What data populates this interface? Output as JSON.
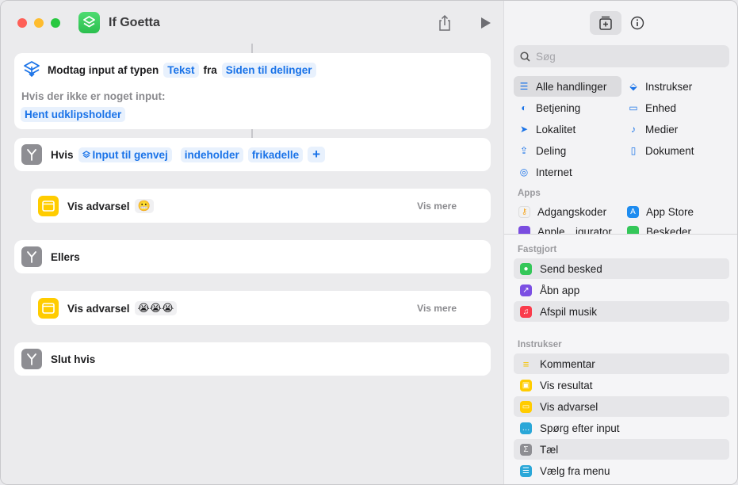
{
  "window": {
    "title": "If Goetta"
  },
  "colors": {
    "accent": "#1a73e8",
    "token_bg": "#e8f1fd",
    "alert_yellow": "#ffcc00",
    "branch_gray": "#8e8e93"
  },
  "toolbar": {
    "share_icon": "share-icon",
    "run_icon": "play-icon"
  },
  "editor": {
    "receive": {
      "label": "Modtag input af typen",
      "type_token": "Tekst",
      "from_label": "fra",
      "source_token": "Siden til delinger",
      "no_input_label": "Hvis der ikke er noget input:",
      "fallback_token": "Hent udklipsholder"
    },
    "if_action": {
      "label": "Hvis",
      "input_token": "Input til genvej",
      "condition_token": "indeholder",
      "value_token": "frikadelle",
      "add_symbol": "+"
    },
    "alert1": {
      "label": "Vis advarsel",
      "emoji": "😬",
      "more": "Vis mere"
    },
    "otherwise": {
      "label": "Ellers"
    },
    "alert2": {
      "label": "Vis advarsel",
      "emoji": "😭😭😭",
      "more": "Vis mere"
    },
    "end_if": {
      "label": "Slut hvis"
    }
  },
  "sidebar": {
    "search_placeholder": "Søg",
    "categories": [
      {
        "label": "Alle handlinger",
        "icon": "list-icon"
      },
      {
        "label": "Instrukser",
        "icon": "scripting-icon"
      },
      {
        "label": "Betjening",
        "icon": "toggle-icon"
      },
      {
        "label": "Enhed",
        "icon": "monitor-icon"
      },
      {
        "label": "Lokalitet",
        "icon": "location-icon"
      },
      {
        "label": "Medier",
        "icon": "music-note-icon"
      },
      {
        "label": "Deling",
        "icon": "share-icon"
      },
      {
        "label": "Dokument",
        "icon": "document-icon"
      },
      {
        "label": "Internet",
        "icon": "compass-icon"
      }
    ],
    "apps_header": "Apps",
    "apps": [
      {
        "label": "Adgangskoder"
      },
      {
        "label": "App Store"
      },
      {
        "label": "Apple…igurator"
      },
      {
        "label": "Beskeder"
      }
    ],
    "pinned_header": "Fastgjort",
    "pinned": [
      {
        "label": "Send besked"
      },
      {
        "label": "Åbn app"
      },
      {
        "label": "Afspil musik"
      }
    ],
    "scripting_header": "Instrukser",
    "scripting": [
      {
        "label": "Kommentar"
      },
      {
        "label": "Vis resultat"
      },
      {
        "label": "Vis advarsel"
      },
      {
        "label": "Spørg efter input"
      },
      {
        "label": "Tæl"
      },
      {
        "label": "Vælg fra menu"
      }
    ]
  }
}
